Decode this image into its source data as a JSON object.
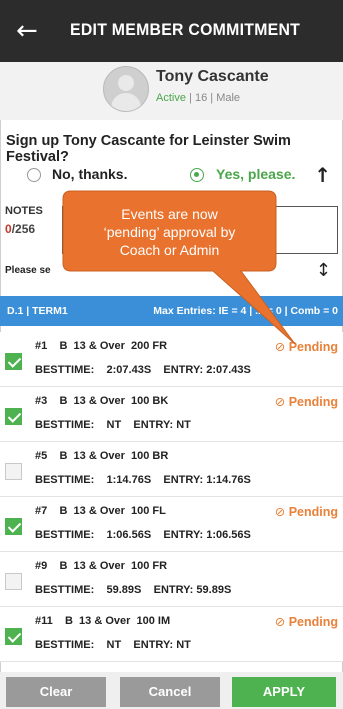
{
  "header": {
    "title": "EDIT MEMBER COMMITMENT",
    "back_icon": "arrow-left-icon"
  },
  "member": {
    "name": "Tony Cascante",
    "status": "Active",
    "age": "16",
    "gender": "Male",
    "sep": "|"
  },
  "signup": {
    "question": "Sign up Tony Cascante for Leinster Swim Festival?",
    "no_label": "No, thanks.",
    "yes_label": "Yes, please.",
    "selected": "yes"
  },
  "notes": {
    "label": "NOTES",
    "count": "0",
    "max": "/256"
  },
  "please_text": "Please se",
  "term_bar": {
    "left": "D.1 | TERM1",
    "right": "Max Entries: IE = 4 | ... = 0 | Comb = 0"
  },
  "callout": {
    "line1": "Events are now",
    "line2": "‘pending’ approval by",
    "line3": "Coach or Admin"
  },
  "events": [
    {
      "num": "#1",
      "line": "B  13 & Over  200 FR",
      "best_label": "BESTTIME:",
      "best": "2:07.43S",
      "entry_label": "ENTRY:",
      "entry": "2:07.43S",
      "checked": true,
      "status": "Pending"
    },
    {
      "num": "#3",
      "line": "B  13 & Over  100 BK",
      "best_label": "BESTTIME:",
      "best": "NT",
      "entry_label": "ENTRY:",
      "entry": "NT",
      "checked": true,
      "status": "Pending"
    },
    {
      "num": "#5",
      "line": "B  13 & Over  100 BR",
      "best_label": "BESTTIME:",
      "best": "1:14.76S",
      "entry_label": "ENTRY:",
      "entry": "1:14.76S",
      "checked": false,
      "status": ""
    },
    {
      "num": "#7",
      "line": "B  13 & Over  100 FL",
      "best_label": "BESTTIME:",
      "best": "1:06.56S",
      "entry_label": "ENTRY:",
      "entry": "1:06.56S",
      "checked": true,
      "status": "Pending"
    },
    {
      "num": "#9",
      "line": "B  13 & Over  100 FR",
      "best_label": "BESTTIME:",
      "best": "59.89S",
      "entry_label": "ENTRY:",
      "entry": "59.89S",
      "checked": false,
      "status": ""
    },
    {
      "num": "#11",
      "line": "B  13 & Over  100 IM",
      "best_label": "BESTTIME:",
      "best": "NT",
      "entry_label": "ENTRY:",
      "entry": "NT",
      "checked": true,
      "status": "Pending"
    }
  ],
  "buttons": {
    "clear": "Clear",
    "cancel": "Cancel",
    "apply": "APPLY"
  },
  "colors": {
    "header_bg": "#2c2c2c",
    "term_bar": "#3b8fd8",
    "accent_green": "#4db24f",
    "pending_orange": "#e8813a",
    "callout": "#e8722e"
  }
}
